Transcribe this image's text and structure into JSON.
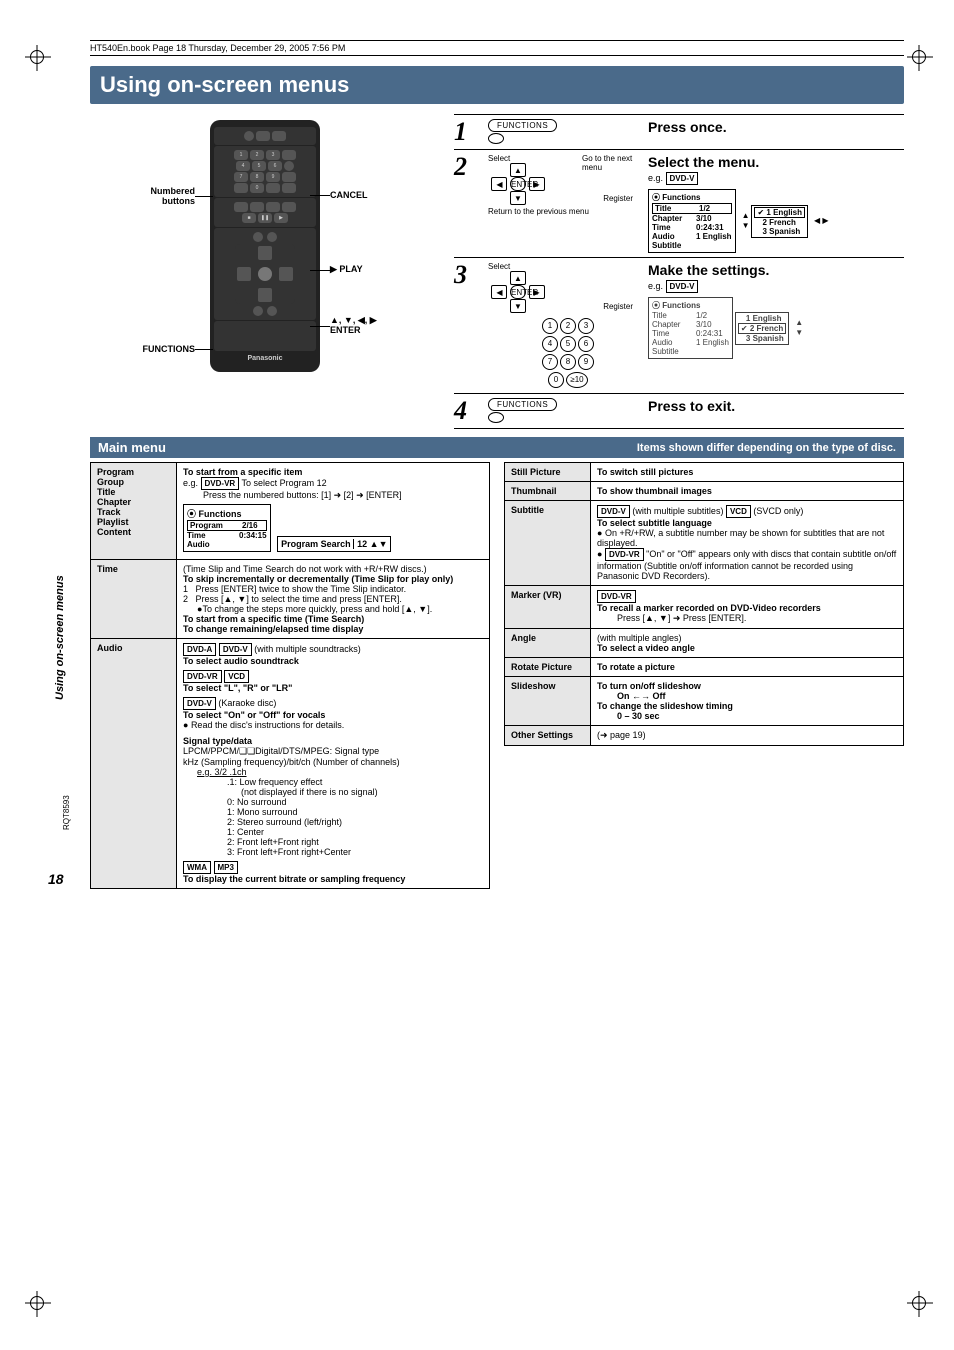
{
  "crop_header": "HT540En.book  Page 18  Thursday, December 29, 2005  7:56 PM",
  "page_title": "Using on-screen menus",
  "remote": {
    "labels_left": {
      "numbered_buttons": "Numbered buttons",
      "functions": "FUNCTIONS"
    },
    "labels_right": {
      "cancel": "CANCEL",
      "play": "▶ PLAY",
      "enter_pad": "▲, ▼, ◀, ▶",
      "enter": "ENTER"
    },
    "brand": "Panasonic"
  },
  "steps": {
    "s1": {
      "num": "1",
      "mid_btn": "FUNCTIONS",
      "right": "Press once."
    },
    "s2": {
      "num": "2",
      "mid_select": "Select",
      "mid_goto": "Go to the next menu",
      "mid_register": "Register",
      "mid_return": "Return to the previous menu",
      "hd": "Select the menu.",
      "eg": "e.g.",
      "tag": "DVD-V",
      "box_title": "Functions",
      "row1": [
        "Title",
        "1/2"
      ],
      "row2": [
        "Chapter",
        "3/10"
      ],
      "row3": [
        "Time",
        "0:24:31"
      ],
      "row4": [
        "Audio",
        "1 English"
      ],
      "row5": [
        "Subtitle",
        ""
      ],
      "options": [
        "1 English",
        "2 French",
        "3 Spanish"
      ],
      "check": "✔"
    },
    "s3": {
      "num": "3",
      "mid_select": "Select",
      "mid_register": "Register",
      "hd": "Make the settings.",
      "eg": "e.g.",
      "tag": "DVD-V",
      "box_title": "Functions",
      "row1": [
        "Title",
        "1/2"
      ],
      "row2": [
        "Chapter",
        "3/10"
      ],
      "row3": [
        "Time",
        "0:24:31"
      ],
      "row4": [
        "Audio",
        "1 English"
      ],
      "row5": [
        "Subtitle",
        ""
      ],
      "options": [
        "1 English",
        "2 French",
        "3 Spanish"
      ],
      "check": "✔",
      "numpad": [
        "1",
        "2",
        "3",
        "4",
        "5",
        "6",
        "7",
        "8",
        "9",
        "0",
        "≥10"
      ]
    },
    "s4": {
      "num": "4",
      "mid_btn": "FUNCTIONS",
      "right": "Press to exit."
    }
  },
  "section_bar": {
    "left": "Main menu",
    "right": "Items shown differ depending on the type of disc."
  },
  "left_table": {
    "r1": {
      "keys": [
        "Program",
        "Group",
        "Title",
        "Chapter",
        "Track",
        "Playlist",
        "Content"
      ],
      "hd": "To start from a specific item",
      "eg_label": "e.g.",
      "eg_tag": "DVD-VR",
      "eg_text": "To select Program 12",
      "eg_seq": "Press the numbered buttons: [1] ➜ [2] ➜ [ENTER]",
      "box_title": "Functions",
      "box_r1": [
        "Program",
        "2/16"
      ],
      "box_r2": [
        "Time",
        "0:34:15"
      ],
      "box_r3": [
        "Audio",
        ""
      ],
      "box_side_label": "Program Search",
      "box_side_val": "12"
    },
    "r2": {
      "key": "Time",
      "p1": "(Time Slip and Time Search do not work with +R/+RW discs.)",
      "p2": "To skip incrementally or decrementally (Time Slip for play only)",
      "li1": "Press [ENTER] twice to show the Time Slip indicator.",
      "li2": "Press [▲, ▼] to select the time and press [ENTER].",
      "li3": "To change the steps more quickly, press and hold [▲, ▼].",
      "p3": "To start from a specific time (Time Search)",
      "p4": "To change remaining/elapsed time display"
    },
    "r3": {
      "key": "Audio",
      "t1": [
        "DVD-A",
        "DVD-V"
      ],
      "t1_text": "(with multiple soundtracks)",
      "l1": "To select audio soundtrack",
      "t2": [
        "DVD-VR",
        "VCD"
      ],
      "l2": "To select \"L\", \"R\" or \"LR\"",
      "t3": [
        "DVD-V"
      ],
      "t3_text": "(Karaoke disc)",
      "l3": "To select \"On\" or \"Off\" for vocals",
      "l3b": "Read the disc's instructions for details.",
      "sig_h": "Signal type/data",
      "sig1": "LPCM/PPCM/❏❏Digital/DTS/MPEG:  Signal type",
      "sig2": "kHz (Sampling frequency)/bit/ch (Number of channels)",
      "sig3": "e.g.  3/2 .1ch",
      "sx": [
        ".1:  Low frequency effect",
        "(not displayed if there is no signal)",
        "0:  No surround",
        "1:  Mono surround",
        "2:  Stereo surround (left/right)",
        "1:  Center",
        "2:  Front left+Front right",
        "3:  Front left+Front right+Center"
      ],
      "t4": [
        "WMA",
        "MP3"
      ],
      "l4": "To display the current bitrate or sampling frequency"
    }
  },
  "right_table": {
    "still": {
      "key": "Still Picture",
      "val": "To switch still pictures"
    },
    "thumb": {
      "key": "Thumbnail",
      "val": "To show thumbnail images"
    },
    "subtitle": {
      "key": "Subtitle",
      "t1": [
        "DVD-V"
      ],
      "t1_text": "(with multiple subtitles)",
      "t2": [
        "VCD"
      ],
      "t2_text": "(SVCD only)",
      "l1": "To select subtitle language",
      "b1": "On +R/+RW, a subtitle number may be shown for subtitles that are not displayed.",
      "t3": [
        "DVD-VR"
      ],
      "b2": "\"On\" or \"Off\" appears only with discs that contain subtitle on/off information (Subtitle on/off information cannot be recorded using Panasonic DVD Recorders)."
    },
    "marker": {
      "key": "Marker (VR)",
      "t": [
        "DVD-VR"
      ],
      "l": "To recall a marker recorded on DVD-Video recorders",
      "seq": "Press [▲, ▼] ➜ Press [ENTER]."
    },
    "angle": {
      "key": "Angle",
      "pre": "(with multiple angles)",
      "l": "To select a video angle"
    },
    "rotate": {
      "key": "Rotate Picture",
      "l": "To rotate a picture"
    },
    "slideshow": {
      "key": "Slideshow",
      "l1": "To turn on/off slideshow",
      "l1b": "On ←→ Off",
      "l2": "To change the slideshow timing",
      "l2b": "0 – 30 sec"
    },
    "other": {
      "key": "Other Settings",
      "val": "(➜ page 19)"
    }
  },
  "side_text": "Using on-screen menus",
  "footer_page": "18",
  "footer_code": "RQT8593"
}
